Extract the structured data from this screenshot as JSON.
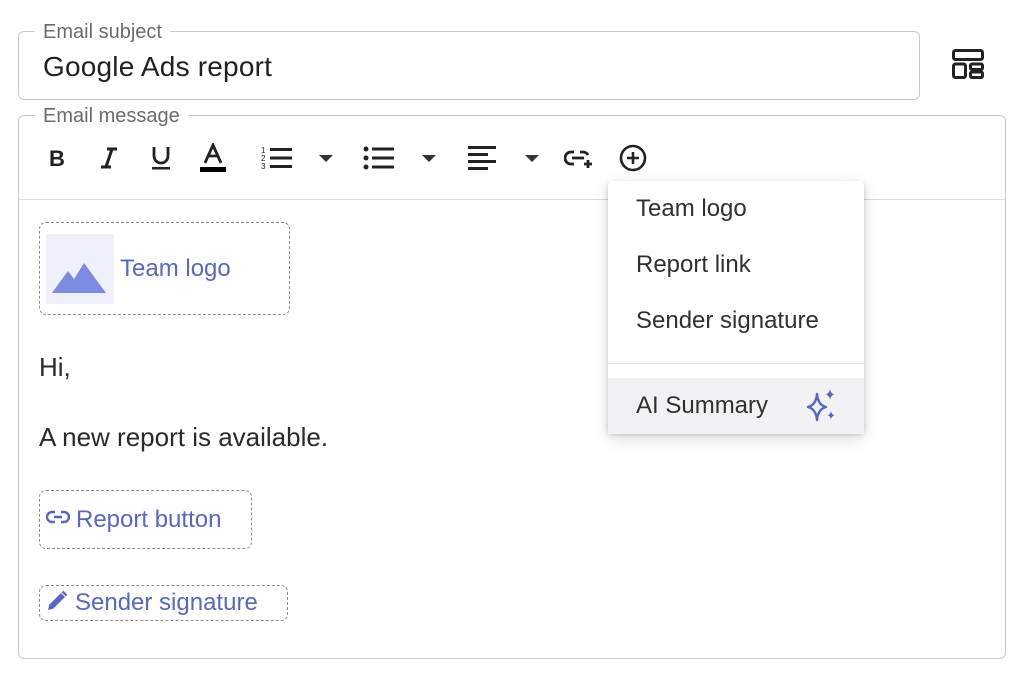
{
  "subject": {
    "legend": "Email subject",
    "value": "Google Ads report"
  },
  "message": {
    "legend": "Email message",
    "toolbar": {
      "icons": [
        "bold-icon",
        "italic-icon",
        "underline-icon",
        "text-color-icon",
        "numbered-list-icon",
        "bulleted-list-icon",
        "align-left-icon",
        "insert-link-icon",
        "add-circle-icon"
      ],
      "text_color": "#000000"
    },
    "blocks": {
      "logo_label": "Team logo",
      "greeting": "Hi,",
      "line1": "A new report is available.",
      "report_label": "Report button",
      "signature_label": "Sender signature"
    }
  },
  "dropdown": {
    "items": [
      "Team logo",
      "Report link",
      "Sender signature"
    ],
    "ai_label": "AI Summary"
  },
  "colors": {
    "accent": "#5968b8",
    "logo_mountain": "#7b8be0",
    "border": "#c9c9c9"
  }
}
